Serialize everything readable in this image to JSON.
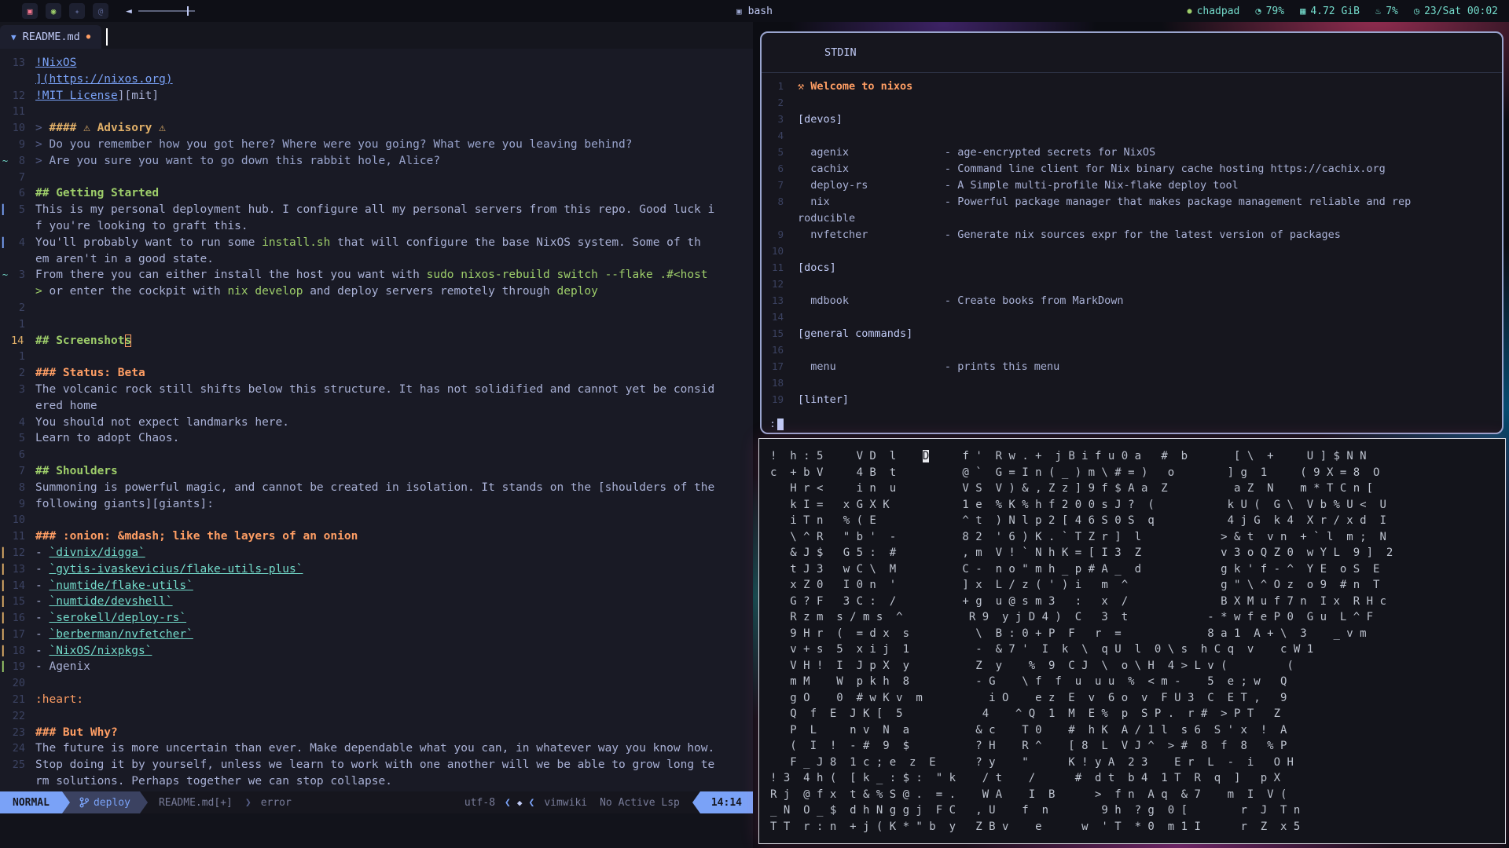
{
  "topbar": {
    "apps": [
      {
        "name": "terminal-app-icon",
        "glyph": "▣",
        "color": "#f7768e"
      },
      {
        "name": "chat-app-icon",
        "glyph": "◉",
        "color": "#9ece6a"
      },
      {
        "name": "tray-icon-1",
        "glyph": "✦",
        "color": "#565f89"
      },
      {
        "name": "tray-icon-2",
        "glyph": "@",
        "color": "#565f89"
      }
    ],
    "volume_icon": "◄",
    "center_icon": "▣",
    "center_label": "bash",
    "status": {
      "dot": "●",
      "host": "chadpad",
      "battery_icon": "◔",
      "battery": "79%",
      "mem_icon": "▦",
      "mem": "4.72 GiB",
      "cpu_icon": "♨",
      "cpu": "7%",
      "clock_icon": "◷",
      "clock": "23/Sat 00:02"
    }
  },
  "editor": {
    "tab": {
      "icon": "▼",
      "title": "README.md",
      "modified_dot": "●"
    },
    "lines": [
      {
        "n": "13",
        "seg": [
          [
            "link",
            "!NixOS"
          ]
        ]
      },
      {
        "seg": [
          [
            "link",
            "](https://nixos.org)"
          ]
        ]
      },
      {
        "n": "12",
        "seg": [
          [
            "link",
            "!MIT License"
          ],
          [
            "text",
            "][mit]"
          ]
        ]
      },
      {
        "n": "11",
        "seg": []
      },
      {
        "n": "10",
        "seg": [
          [
            "quotemark",
            "> "
          ],
          [
            "h4",
            "#### ⚠ Advisory ⚠"
          ]
        ]
      },
      {
        "n": "9",
        "seg": [
          [
            "quotemark",
            "> "
          ],
          [
            "quote",
            "Do you remember how you got here? Where were you going? What were you leaving behind?"
          ]
        ]
      },
      {
        "n": "8",
        "sign": "tilde",
        "seg": [
          [
            "quotemark",
            "> "
          ],
          [
            "quote",
            "Are you sure you want to go down this rabbit hole, Alice?"
          ]
        ]
      },
      {
        "n": "7",
        "seg": []
      },
      {
        "n": "6",
        "seg": [
          [
            "h2",
            "## Getting Started"
          ]
        ]
      },
      {
        "n": "5",
        "sign": "barb",
        "seg": [
          [
            "text",
            "This is my personal deployment hub. I configure all my personal servers from this repo. Good luck i"
          ]
        ]
      },
      {
        "seg": [
          [
            "text",
            "f you're looking to graft this."
          ]
        ]
      },
      {
        "n": "4",
        "sign": "barb",
        "seg": [
          [
            "text",
            "You'll probably want to run some "
          ],
          [
            "code",
            "install.sh"
          ],
          [
            "text",
            " that will configure the base NixOS system. Some of th"
          ]
        ]
      },
      {
        "seg": [
          [
            "text",
            "em aren't in a good state."
          ]
        ]
      },
      {
        "n": "3",
        "sign": "tilde",
        "seg": [
          [
            "text",
            "From there you can either install the host you want with "
          ],
          [
            "code",
            "sudo nixos-rebuild switch --flake .#<host"
          ]
        ]
      },
      {
        "seg": [
          [
            "code",
            ">"
          ],
          [
            "text",
            " or enter the cockpit with "
          ],
          [
            "code",
            "nix develop"
          ],
          [
            "text",
            " and deploy servers remotely through "
          ],
          [
            "code",
            "deploy"
          ]
        ]
      },
      {
        "n": "2",
        "seg": []
      },
      {
        "n": "1",
        "seg": []
      },
      {
        "n": "14",
        "cur": true,
        "seg": [
          [
            "h2",
            "## Screenshot"
          ],
          [
            "cursor",
            "s"
          ]
        ]
      },
      {
        "n": "1",
        "seg": []
      },
      {
        "n": "2",
        "seg": [
          [
            "h3",
            "### Status: Beta"
          ]
        ]
      },
      {
        "n": "3",
        "seg": [
          [
            "text",
            "The volcanic rock still shifts below this structure. It has not solidified and cannot yet be consid"
          ]
        ]
      },
      {
        "seg": [
          [
            "text",
            "ered home"
          ]
        ]
      },
      {
        "n": "4",
        "seg": [
          [
            "text",
            "You should not expect landmarks here."
          ]
        ]
      },
      {
        "n": "5",
        "seg": [
          [
            "text",
            "Learn to adopt Chaos."
          ]
        ]
      },
      {
        "n": "6",
        "seg": []
      },
      {
        "n": "7",
        "seg": [
          [
            "h2",
            "## Shoulders"
          ]
        ]
      },
      {
        "n": "8",
        "seg": [
          [
            "text",
            "Summoning is powerful magic, and cannot be created in isolation. It stands on the [shoulders of the"
          ]
        ]
      },
      {
        "n": "9",
        "seg": [
          [
            "text",
            "following giants][giants]:"
          ]
        ]
      },
      {
        "n": "10",
        "seg": []
      },
      {
        "n": "11",
        "seg": [
          [
            "h3",
            "### :onion: &mdash; like the layers of an onion"
          ]
        ]
      },
      {
        "n": "12",
        "sign": "baro",
        "seg": [
          [
            "text",
            "- "
          ],
          [
            "linkcode",
            "`divnix/digga`"
          ]
        ]
      },
      {
        "n": "13",
        "sign": "baro",
        "seg": [
          [
            "text",
            "- "
          ],
          [
            "linkcode",
            "`gytis-ivaskevicius/flake-utils-plus`"
          ]
        ]
      },
      {
        "n": "14",
        "sign": "baro",
        "seg": [
          [
            "text",
            "- "
          ],
          [
            "linkcode",
            "`numtide/flake-utils`"
          ]
        ]
      },
      {
        "n": "15",
        "sign": "baro",
        "seg": [
          [
            "text",
            "- "
          ],
          [
            "linkcode",
            "`numtide/devshell`"
          ]
        ]
      },
      {
        "n": "16",
        "sign": "baro",
        "seg": [
          [
            "text",
            "- "
          ],
          [
            "linkcode",
            "`serokell/deploy-rs`"
          ]
        ]
      },
      {
        "n": "17",
        "sign": "baro",
        "seg": [
          [
            "text",
            "- "
          ],
          [
            "linkcode",
            "`berberman/nvfetcher`"
          ]
        ]
      },
      {
        "n": "18",
        "sign": "baro",
        "seg": [
          [
            "text",
            "- "
          ],
          [
            "linkcode",
            "`NixOS/nixpkgs`"
          ]
        ]
      },
      {
        "n": "19",
        "sign": "barg",
        "seg": [
          [
            "text",
            "- Agenix"
          ]
        ]
      },
      {
        "n": "20",
        "seg": []
      },
      {
        "n": "21",
        "seg": [
          [
            "emoji",
            ":heart:"
          ]
        ]
      },
      {
        "n": "22",
        "seg": []
      },
      {
        "n": "23",
        "seg": [
          [
            "h3",
            "### But Why?"
          ]
        ]
      },
      {
        "n": "24",
        "seg": [
          [
            "text",
            "The future is more uncertain than ever. Make dependable what you can, in whatever way you know how."
          ]
        ]
      },
      {
        "n": "25",
        "seg": [
          [
            "text",
            "Stop doing it by yourself, unless we learn to work with one another will we be able to grow long te"
          ]
        ]
      },
      {
        "seg": [
          [
            "text",
            "rm solutions. Perhaps together we can stop collapse."
          ]
        ]
      }
    ],
    "statusline": {
      "mode": "NORMAL",
      "branch": "deploy",
      "file": "README.md[+]",
      "chev_r": "❯",
      "error": "error",
      "enc": "utf-8",
      "chev_l": "❮",
      "vim_icon": "◆",
      "plugin": "vimwiki",
      "lsp": "No Active Lsp",
      "time": "14:14"
    }
  },
  "pager": {
    "title": "STDIN",
    "prompt": ":",
    "rows": [
      {
        "n": "1",
        "style": "welcome",
        "text": "⚒ Welcome to nixos"
      },
      {
        "n": "2",
        "text": ""
      },
      {
        "n": "3",
        "style": "section",
        "text": "[devos]"
      },
      {
        "n": "4",
        "text": ""
      },
      {
        "n": "5",
        "text": "  agenix               - age-encrypted secrets for NixOS"
      },
      {
        "n": "6",
        "text": "  cachix               - Command line client for Nix binary cache hosting https://cachix.org"
      },
      {
        "n": "7",
        "text": "  deploy-rs            - A Simple multi-profile Nix-flake deploy tool"
      },
      {
        "n": "8",
        "text": "  nix                  - Powerful package manager that makes package management reliable and rep"
      },
      {
        "text": "roducible"
      },
      {
        "n": "9",
        "text": "  nvfetcher            - Generate nix sources expr for the latest version of packages"
      },
      {
        "n": "10",
        "text": ""
      },
      {
        "n": "11",
        "style": "section",
        "text": "[docs]"
      },
      {
        "n": "12",
        "text": ""
      },
      {
        "n": "13",
        "text": "  mdbook               - Create books from MarkDown"
      },
      {
        "n": "14",
        "text": ""
      },
      {
        "n": "15",
        "style": "section",
        "text": "[general commands]"
      },
      {
        "n": "16",
        "text": ""
      },
      {
        "n": "17",
        "text": "  menu                 - prints this menu"
      },
      {
        "n": "18",
        "text": ""
      },
      {
        "n": "19",
        "style": "section",
        "text": "[linter]"
      }
    ]
  },
  "glyphs": {
    "cursor": {
      "row": 0,
      "col": 23
    },
    "rows": [
      "!  h : 5     V D  l    D     f '  R w . +  j B i f u 0 a   #  b       [ \\  +     U ] $ N N",
      "c  + b V     4 B  t          @ `  G = I n ( _ ) m \\ # = )   o        ] g  1     ( 9 X = 8  O",
      "   H r <     i n  u          V S  V ) & , Z z ] 9 f $ A a  Z          a Z  N    m * T C n [",
      "   k I =   x G X K           1 e  % K % h f 2 0 0 s J ?  (           k U (  G \\  V b % U <  U",
      "   i T n   % ( E             ^ t  ) N l p 2 [ 4 6 S 0 S  q           4 j G  k 4  X r / x d  I",
      "   \\ ^ R   \" b '  -          8 2  ' 6 ) K . ` T Z r ]  l            > & t  v n  + ` l  m ;  N",
      "   & J $   G 5 :  #          , m  V ! ` N h K = [ I 3  Z            v 3 o Q Z 0  w Y L  9 ]  2",
      "   t J 3   w C \\  M          C -  n o \" m h _ p # A _  d            g k ' f - ^  Y E  o S  E",
      "   x Z 0   I 0 n  '          ] x  L / z ( ' ) i   m  ^              g \" \\ ^ O z  o 9  # n  T",
      "   G ? F   3 C :  /          + g  u @ s m 3   :   x  /              B X M u f 7 n  I x  R H c",
      "   R z m  s / m s  ^          R 9  y j D 4 )  C   3  t            - * w f e P 0  G u  L ^ F",
      "   9 H r  (  = d x  s          \\  B : 0 + P  F   r  =             8 a 1  A + \\  3    _ v m",
      "   v + s  5  x i j  1          -  & 7 '  I  k  \\  q U  l  0 \\ s  h C q  v    c W 1",
      "   V H !  I  J p X  y          Z  y    %  9  C J  \\  o \\ H  4 > L v (         (",
      "   m M    W  p k h  8          - G    \\ f  f  u  u u  %  < m -    5  e ; w   Q",
      "   g O    0  # w K v  m          i O    e z  E  v  6 o  v  F U 3  C  E T ,   9",
      "   Q  f  E  J K [  5            4    ^ Q  1  M  E %  p  S P .  r #  > P T   Z",
      "   P  L     n v  N  a          & c    T 0    #  h K  A / 1 l  s 6  S ' x  !  A",
      "   (  I  !  - #  9  $          ? H    R ^    [ 8  L  V J ^  > #  8  f  8   % P",
      "   F _ J 8  1 c ; e  z  E      ? y    \"      K ! y A  2 3    E r  L  -  i   O H",
      "! 3  4 h (  [ k _ : $ :  \" k    / t    /      #  d t  b 4  1 T  R  q  ]   p X",
      "R j  @ f x  t & % S @ .  = .    W A    I  B      >  f n  A q  & 7    m  I  V (",
      "_ N  O _ $  d h N g g j  F C   , U    f  n        9 h  ? g  0 [        r  J  T n",
      "T T  r : n  + j ( K * \" b  y   Z B v    e      w  ' T  * 0  m 1 I      r  Z  x 5"
    ]
  }
}
